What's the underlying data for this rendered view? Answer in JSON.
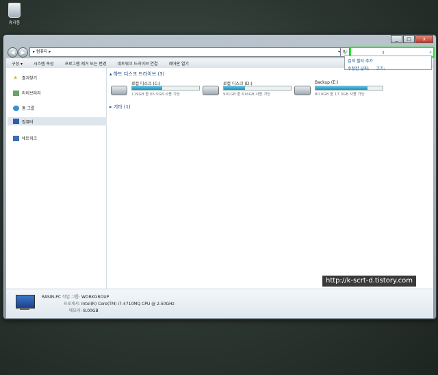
{
  "desktop": {
    "recycle_bin_label": "휴지통"
  },
  "window": {
    "min": "_",
    "max": "□",
    "close": "x"
  },
  "address_bar": {
    "back": "◀",
    "forward": "▶",
    "path": "▸ 컴퓨터 ▸",
    "dropdown": "▾",
    "refresh": "↻"
  },
  "search": {
    "placeholder": "",
    "caret": "I",
    "icon": "⌕"
  },
  "search_dropdown": {
    "title": "검색 필터 추가",
    "filter1": "수정한 날짜:",
    "filter2": "크기:"
  },
  "toolbar": [
    "구성 ▾",
    "시스템 속성",
    "프로그램 제거 또는 변경",
    "네트워크 드라이브 연결",
    "제어판 열기"
  ],
  "nav": {
    "favorites": "즐겨찾기",
    "libraries": "라이브러리",
    "homegroup": "홈 그룹",
    "computer": "컴퓨터",
    "network": "네트워크"
  },
  "content": {
    "hdd_group": "▴ 하드 디스크 드라이브 (3)",
    "other_group": "▸ 기타 (1)",
    "drives": [
      {
        "name": "로컬 디스크 (C:)",
        "info": "119GB 중 65.5GB 사용 가능",
        "used": 0.45
      },
      {
        "name": "로컬 디스크 (D:)",
        "info": "901GB 중 616GB 사용 가능",
        "used": 0.32
      },
      {
        "name": "Backup (E:)",
        "info": "80.0GB 중 17.3GB 사용 가능",
        "used": 0.78
      }
    ]
  },
  "details": {
    "pc_name": "RASIN-PC",
    "workgroup_label": "작업 그룹:",
    "workgroup": "WORKGROUP",
    "cpu_label": "프로세서:",
    "cpu": "Intel(R) Core(TM) i7-4710MQ CPU @ 2.50GHz",
    "mem_label": "메모리:",
    "mem": "8.00GB"
  },
  "watermark": "http://k-scrt-d.tistory.com",
  "colors": {
    "search_highlight": "#35e03a",
    "usage_bar": "#1b8fc0"
  }
}
